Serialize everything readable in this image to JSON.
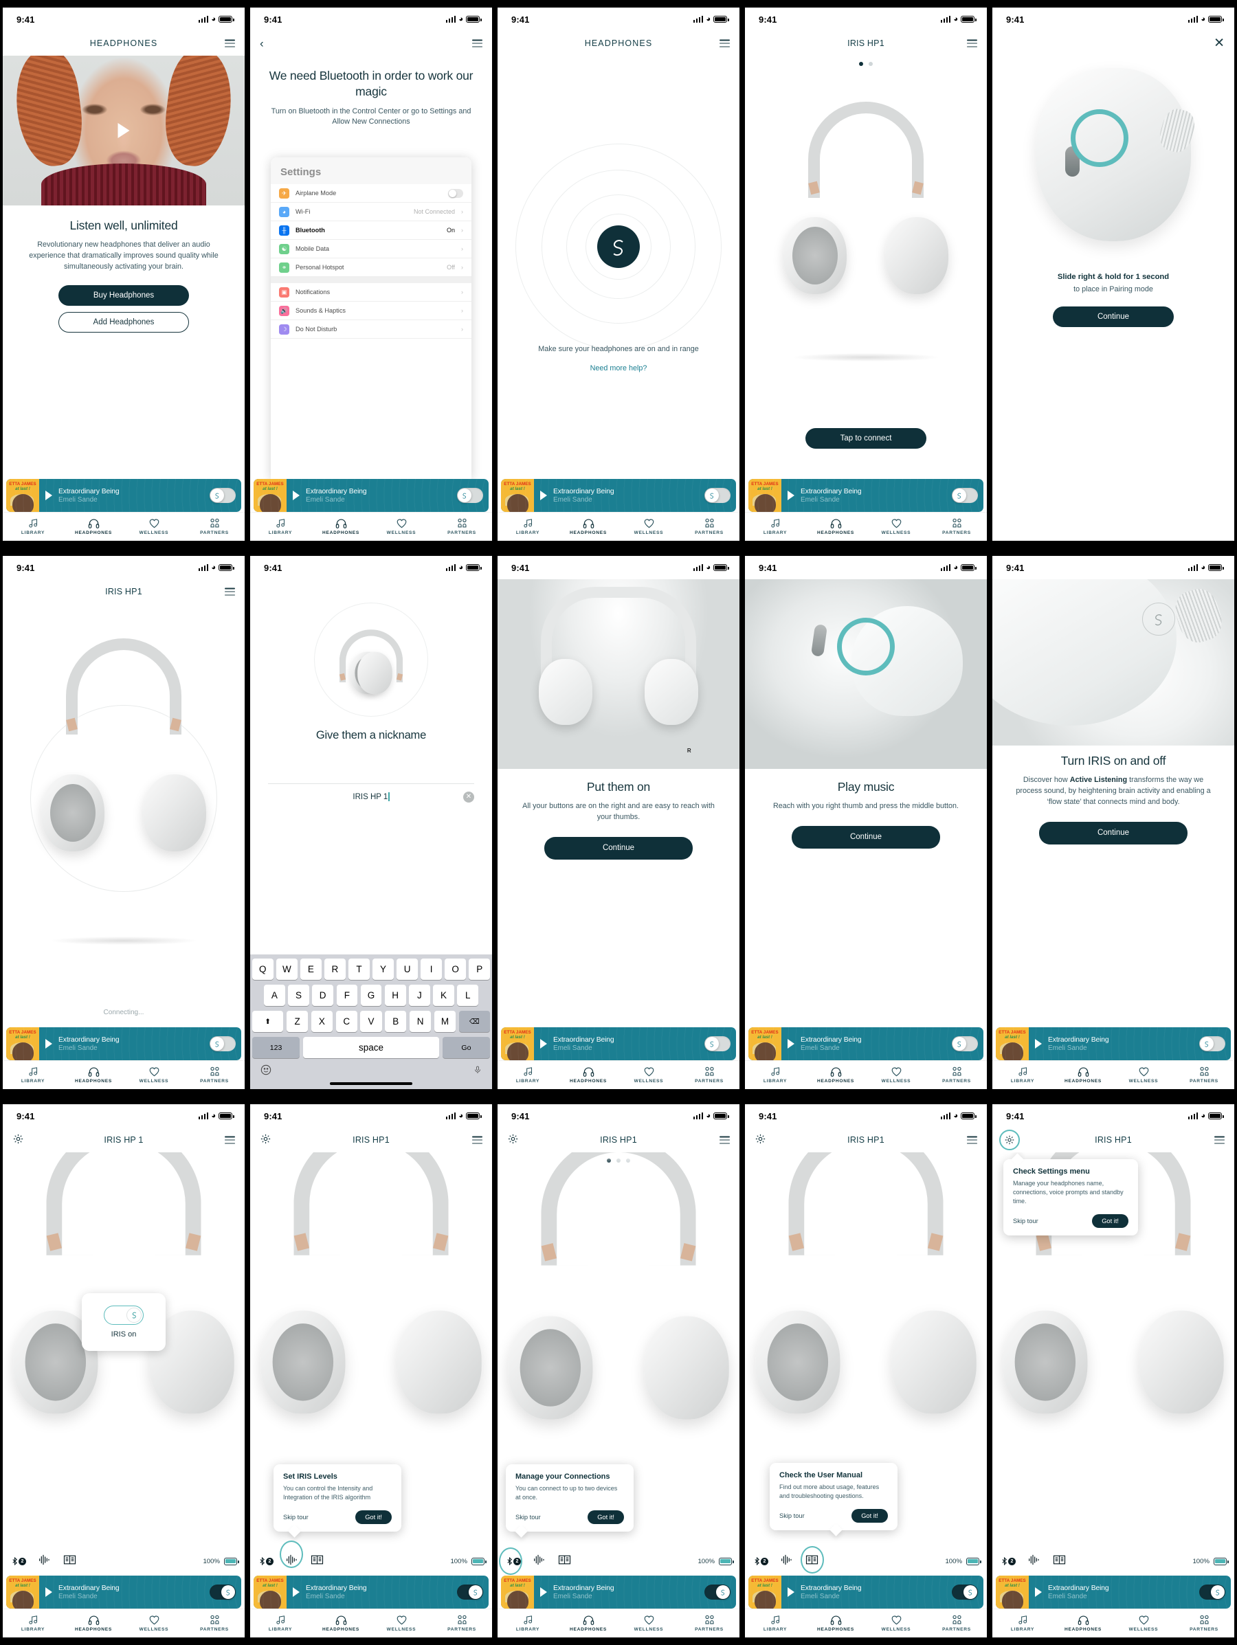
{
  "status_bar": {
    "time": "9:41"
  },
  "app": {
    "brand_dark": "#0f3039",
    "brand_teal": "#5ebcbc",
    "player_teal": "#1b7f92"
  },
  "tabs": [
    {
      "label": "LIBRARY",
      "icon": "music-note-icon"
    },
    {
      "label": "HEADPHONES",
      "icon": "headphones-icon"
    },
    {
      "label": "WELLNESS",
      "icon": "heart-icon"
    },
    {
      "label": "PARTNERS",
      "icon": "partners-grid-icon"
    }
  ],
  "player": {
    "album_line1": "ETTA JAMES",
    "album_line2": "at last !",
    "track": "Extraordinary Being",
    "artist": "Emeli Sande"
  },
  "control_bar": {
    "bluetooth_count": "2",
    "battery_percent": "100%"
  },
  "screens": [
    {
      "id": "listen-well",
      "nav_title": "HEADPHONES",
      "nav_right": "hamburger-icon",
      "heading": "Listen well, unlimited",
      "body": "Revolutionary new headphones that deliver an audio experience that dramatically improves sound quality while simultaneously activating your brain.",
      "primary_button": "Buy Headphones",
      "secondary_button": "Add Headphones"
    },
    {
      "id": "bluetooth-needed",
      "nav_left": "back-chevron-icon",
      "nav_right": "hamburger-icon",
      "heading": "We need Bluetooth in order to work our magic",
      "body": "Turn on Bluetooth in the Control Center or go to Settings and Allow New Connections",
      "settings": {
        "title": "Settings",
        "rows": [
          {
            "label": "Airplane Mode",
            "value": "",
            "control": "toggle",
            "icon": "airplane-icon",
            "color": "#f6a947"
          },
          {
            "label": "Wi-Fi",
            "value": "Not Connected",
            "control": "chevron",
            "icon": "wifi-icon",
            "color": "#5aa9f8"
          },
          {
            "label": "Bluetooth",
            "value": "On",
            "control": "chevron",
            "icon": "bluetooth-icon",
            "color": "#0a74f0",
            "active": true
          },
          {
            "label": "Mobile Data",
            "value": "",
            "control": "chevron",
            "icon": "antenna-icon",
            "color": "#6fd08c"
          },
          {
            "label": "Personal Hotspot",
            "value": "Off",
            "control": "chevron",
            "icon": "hotspot-icon",
            "color": "#6fd08c"
          },
          {
            "label": "Notifications",
            "value": "",
            "control": "chevron",
            "icon": "notifications-icon",
            "color": "#fa7a72"
          },
          {
            "label": "Sounds & Haptics",
            "value": "",
            "control": "chevron",
            "icon": "speaker-icon",
            "color": "#fa6f9b"
          },
          {
            "label": "Do Not Disturb",
            "value": "",
            "control": "chevron",
            "icon": "moon-icon",
            "color": "#9f8bf0"
          }
        ]
      }
    },
    {
      "id": "searching",
      "nav_title": "HEADPHONES",
      "nav_right": "hamburger-icon",
      "body": "Make sure your headphones are on and in range",
      "help_link": "Need more help?"
    },
    {
      "id": "tap-to-connect",
      "nav_title": "IRIS HP1",
      "nav_right": "hamburger-icon",
      "pagination": {
        "count": 2,
        "active": 0
      },
      "primary_button": "Tap to connect"
    },
    {
      "id": "pairing-mode",
      "nav_right": "close-icon",
      "heading": "Slide right & hold for 1 second",
      "body": "to place in Pairing mode",
      "primary_button": "Continue"
    },
    {
      "id": "connecting",
      "nav_title": "IRIS HP1",
      "nav_right": "hamburger-icon",
      "status": "Connecting..."
    },
    {
      "id": "nickname",
      "heading": "Give them a nickname",
      "input_value": "IRIS HP 1",
      "keyboard": {
        "row1": [
          "Q",
          "W",
          "E",
          "R",
          "T",
          "Y",
          "U",
          "I",
          "O",
          "P"
        ],
        "row2": [
          "A",
          "S",
          "D",
          "F",
          "G",
          "H",
          "J",
          "K",
          "L"
        ],
        "row3": [
          "Z",
          "X",
          "C",
          "V",
          "B",
          "N",
          "M"
        ],
        "shift": "shift-icon",
        "backspace": "backspace-icon",
        "numbers": "123",
        "space": "space",
        "go": "Go",
        "emoji": "emoji-icon",
        "mic": "microphone-icon"
      }
    },
    {
      "id": "put-them-on",
      "heading": "Put them on",
      "body": "All your buttons are on the right and are easy to reach with your thumbs.",
      "primary_button": "Continue",
      "marker": "R"
    },
    {
      "id": "play-music",
      "heading": "Play music",
      "body": "Reach with you right thumb and press the middle button.",
      "primary_button": "Continue"
    },
    {
      "id": "turn-iris",
      "heading": "Turn IRIS on and off",
      "body_pre": "Discover how ",
      "body_bold": "Active Listening",
      "body_post": " transforms the way we process sound, by heightening brain activity and enabling a ‘flow state’ that connects mind and body.",
      "primary_button": "Continue"
    },
    {
      "id": "iris-on",
      "nav_title": "IRIS HP 1",
      "nav_left": "gear-icon",
      "nav_right": "hamburger-icon",
      "pill_label": "IRIS on"
    },
    {
      "id": "tour-iris-levels",
      "nav_title": "IRIS HP1",
      "nav_left": "gear-icon",
      "nav_right": "hamburger-icon",
      "tooltip": {
        "title": "Set IRIS Levels",
        "body": "You can control the Intensity and Integration of the IRIS algorithm",
        "skip": "Skip tour",
        "confirm": "Got it!"
      },
      "highlight": "waveform-icon"
    },
    {
      "id": "tour-connections",
      "nav_title": "IRIS HP1",
      "nav_left": "gear-icon",
      "nav_right": "hamburger-icon",
      "pagination": {
        "count": 3,
        "active": 0
      },
      "tooltip": {
        "title": "Manage your Connections",
        "body": "You can connect to up to two devices at once.",
        "skip": "Skip tour",
        "confirm": "Got it!"
      },
      "highlight": "bluetooth-icon"
    },
    {
      "id": "tour-user-manual",
      "nav_title": "IRIS HP1",
      "nav_left": "gear-icon",
      "nav_right": "hamburger-icon",
      "tooltip": {
        "title": "Check the User Manual",
        "body": "Find out more about usage, features and troubleshooting questions.",
        "skip": "Skip tour",
        "confirm": "Got it!"
      },
      "highlight": "manual-icon"
    },
    {
      "id": "tour-settings-menu",
      "nav_title": "IRIS HP1",
      "nav_left": "gear-icon",
      "nav_right": "hamburger-icon",
      "tooltip": {
        "title": "Check Settings menu",
        "body": "Manage your headphones name, connections, voice prompts and standby time.",
        "skip": "Skip tour",
        "confirm": "Got it!"
      },
      "highlight": "gear-icon"
    }
  ]
}
